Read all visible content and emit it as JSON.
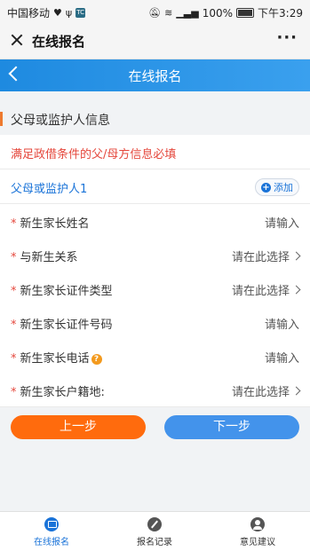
{
  "status_bar": {
    "carrier": "中国移动",
    "battery": "100%",
    "time": "下午3:29"
  },
  "wechat_bar": {
    "title": "在线报名",
    "more": "···"
  },
  "app_header": {
    "title": "在线报名"
  },
  "section": {
    "title": "父母或监护人信息",
    "notice": "满足政借条件的父/母方信息必填",
    "guardian_label": "父母或监护人1",
    "add_label": "添加"
  },
  "fields": [
    {
      "required": "*",
      "label": "新生家长姓名",
      "value": "请输入",
      "type": "input"
    },
    {
      "required": "*",
      "label": "与新生关系",
      "value": "请在此选择",
      "type": "select"
    },
    {
      "required": "*",
      "label": "新生家长证件类型",
      "value": "请在此选择",
      "type": "select"
    },
    {
      "required": "*",
      "label": "新生家长证件号码",
      "value": "请输入",
      "type": "input"
    },
    {
      "required": "*",
      "label": "新生家长电话",
      "value": "请输入",
      "type": "input",
      "help": "?"
    },
    {
      "required": "*",
      "label": "新生家长户籍地:",
      "value": "请在此选择",
      "type": "select"
    }
  ],
  "buttons": {
    "prev": "上一步",
    "next": "下一步"
  },
  "tabs": [
    {
      "label": "在线报名",
      "icon": "online-apply-icon",
      "active": true
    },
    {
      "label": "报名记录",
      "icon": "record-icon",
      "active": false
    },
    {
      "label": "意见建议",
      "icon": "advice-icon",
      "active": false
    }
  ],
  "colors": {
    "header_blue": "#1e8ae0",
    "prev_orange": "#ff6b0d",
    "next_blue": "#4393eb",
    "required_red": "#e5483d",
    "link_blue": "#1a73d8"
  }
}
